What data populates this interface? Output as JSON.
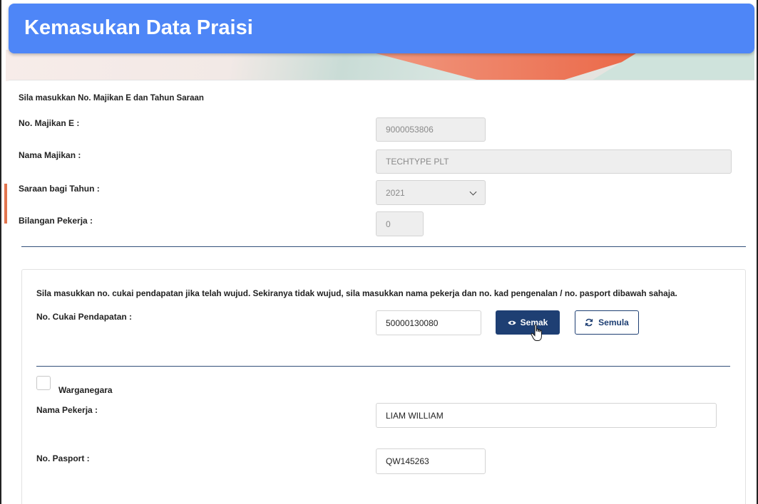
{
  "header": {
    "title": "Kemasukan Data Praisi"
  },
  "section1": {
    "instruction": "Sila masukkan No. Majikan E dan Tahun Saraan",
    "employer_no_label": "No. Majikan E :",
    "employer_no_value": "9000053806",
    "employer_name_label": "Nama Majikan :",
    "employer_name_value": "TECHTYPE PLT",
    "year_label": "Saraan bagi Tahun :",
    "year_value": "2021",
    "worker_count_label": "Bilangan Pekerja :",
    "worker_count_value": "0"
  },
  "section2": {
    "instruction": "Sila masukkan no. cukai pendapatan jika telah wujud. Sekiranya tidak wujud, sila masukkan nama pekerja dan no. kad pengenalan / no. pasport dibawah sahaja.",
    "tax_no_label": "No. Cukai Pendapatan :",
    "tax_no_value": "50000130080",
    "check_button_label": "Semak",
    "reset_button_label": "Semula",
    "citizen_label": "Warganegara",
    "worker_name_label": "Nama Pekerja :",
    "worker_name_value": "LIAM WILLIAM",
    "passport_label": "No. Pasport :",
    "passport_value": "QW145263"
  },
  "icons": {
    "check_button_icon": "eye-icon",
    "reset_button_icon": "refresh-icon",
    "year_dropdown_icon": "chevron-down-icon",
    "cursor_icon": "hand-pointer-icon"
  },
  "colors": {
    "header_bg": "#4e86f7",
    "primary_button": "#1e3f73",
    "accent_orange": "#ea6443"
  }
}
